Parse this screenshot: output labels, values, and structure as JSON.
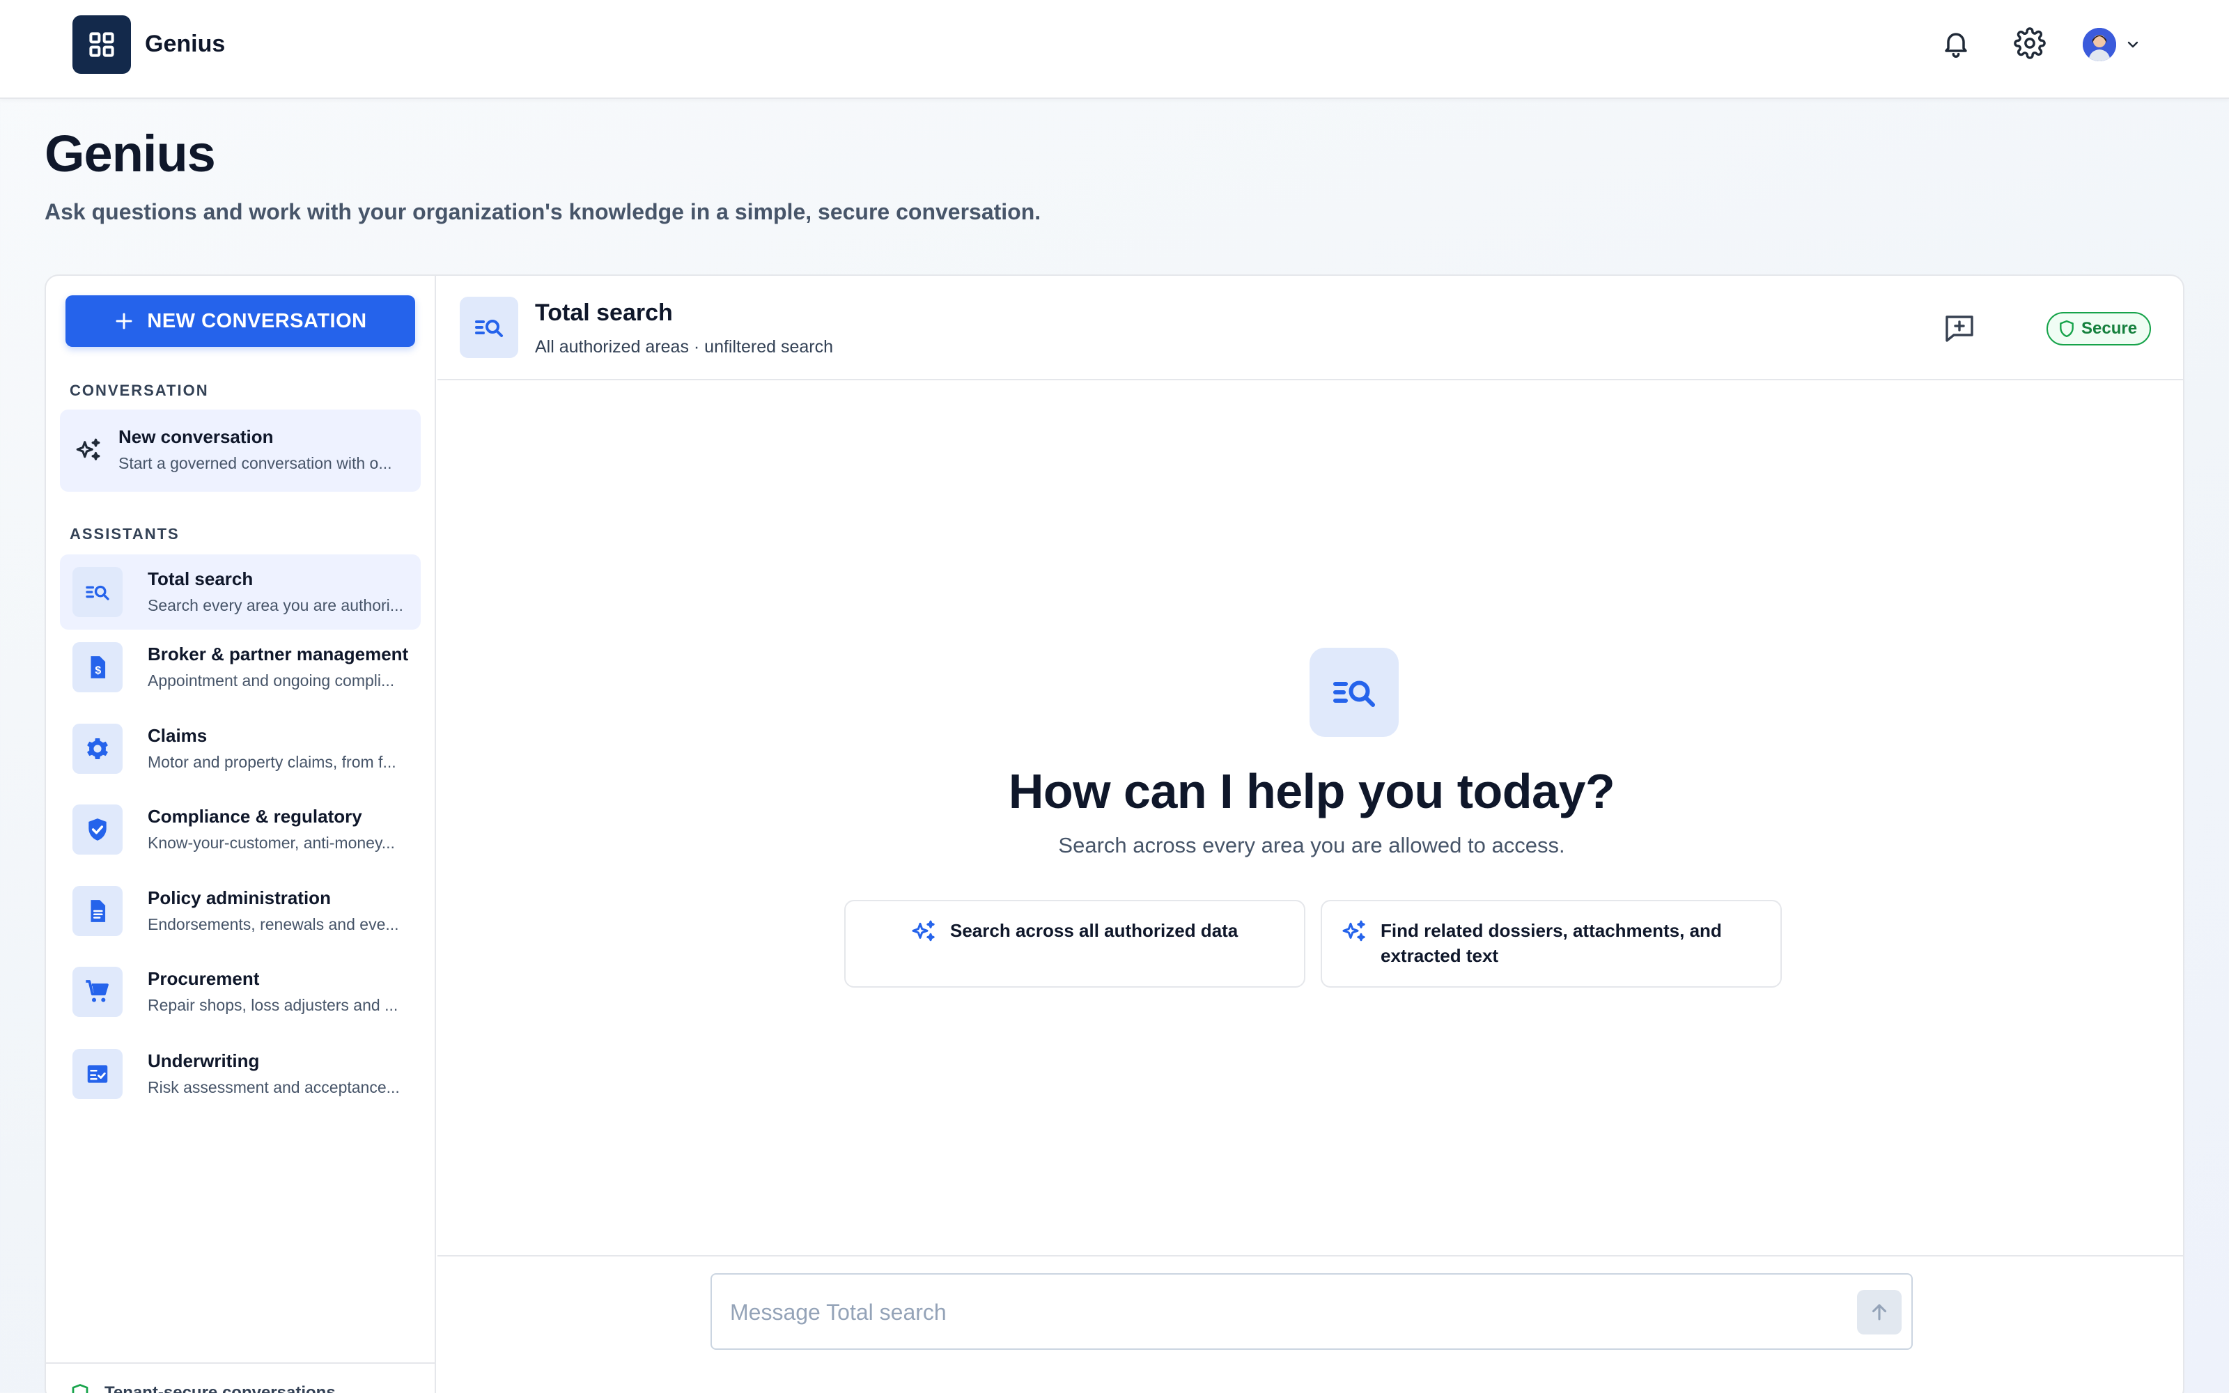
{
  "topbar": {
    "brand": "Genius",
    "icons": {
      "apps": "grid-icon",
      "notifications": "bell-icon",
      "settings": "gear-icon",
      "menu": "chevron-down-icon"
    }
  },
  "page": {
    "title": "Genius",
    "subtitle": "Ask questions and work with your organization's knowledge in a simple, secure conversation."
  },
  "sidebar": {
    "new_button_label": "NEW CONVERSATION",
    "conversation_section": "CONVERSATION",
    "conversation_item": {
      "title": "New conversation",
      "description": "Start a governed conversation with o..."
    },
    "assistants_section": "ASSISTANTS",
    "assistants": [
      {
        "title": "Total search",
        "description": "Search every area you are authori...",
        "icon": "search-list-icon",
        "active": true
      },
      {
        "title": "Broker & partner management",
        "description": "Appointment and ongoing compli...",
        "icon": "dollar-document-icon",
        "active": false
      },
      {
        "title": "Claims",
        "description": "Motor and property claims, from f...",
        "icon": "gear-icon",
        "active": false
      },
      {
        "title": "Compliance & regulatory",
        "description": "Know-your-customer, anti-money...",
        "icon": "shield-check-icon",
        "active": false
      },
      {
        "title": "Policy administration",
        "description": "Endorsements, renewals and eve...",
        "icon": "document-icon",
        "active": false
      },
      {
        "title": "Procurement",
        "description": "Repair shops, loss adjusters and ...",
        "icon": "cart-icon",
        "active": false
      },
      {
        "title": "Underwriting",
        "description": "Risk assessment and acceptance...",
        "icon": "checklist-icon",
        "active": false
      }
    ],
    "footer_text": "Tenant-secure conversations"
  },
  "main": {
    "header": {
      "title": "Total search",
      "subtitle": "All authorized areas · unfiltered search",
      "badge": "Secure"
    },
    "empty_state": {
      "title": "How can I help you today?",
      "subtitle": "Search across every area you are allowed to access.",
      "suggestions": [
        "Search across all authorized data",
        "Find related dossiers, attachments, and extracted text"
      ]
    },
    "composer": {
      "placeholder": "Message Total search"
    }
  },
  "colors": {
    "accent": "#2563eb",
    "brand_dark": "#13294b",
    "secure_green": "#16a34a",
    "tile_bg": "#e0e9fb"
  }
}
